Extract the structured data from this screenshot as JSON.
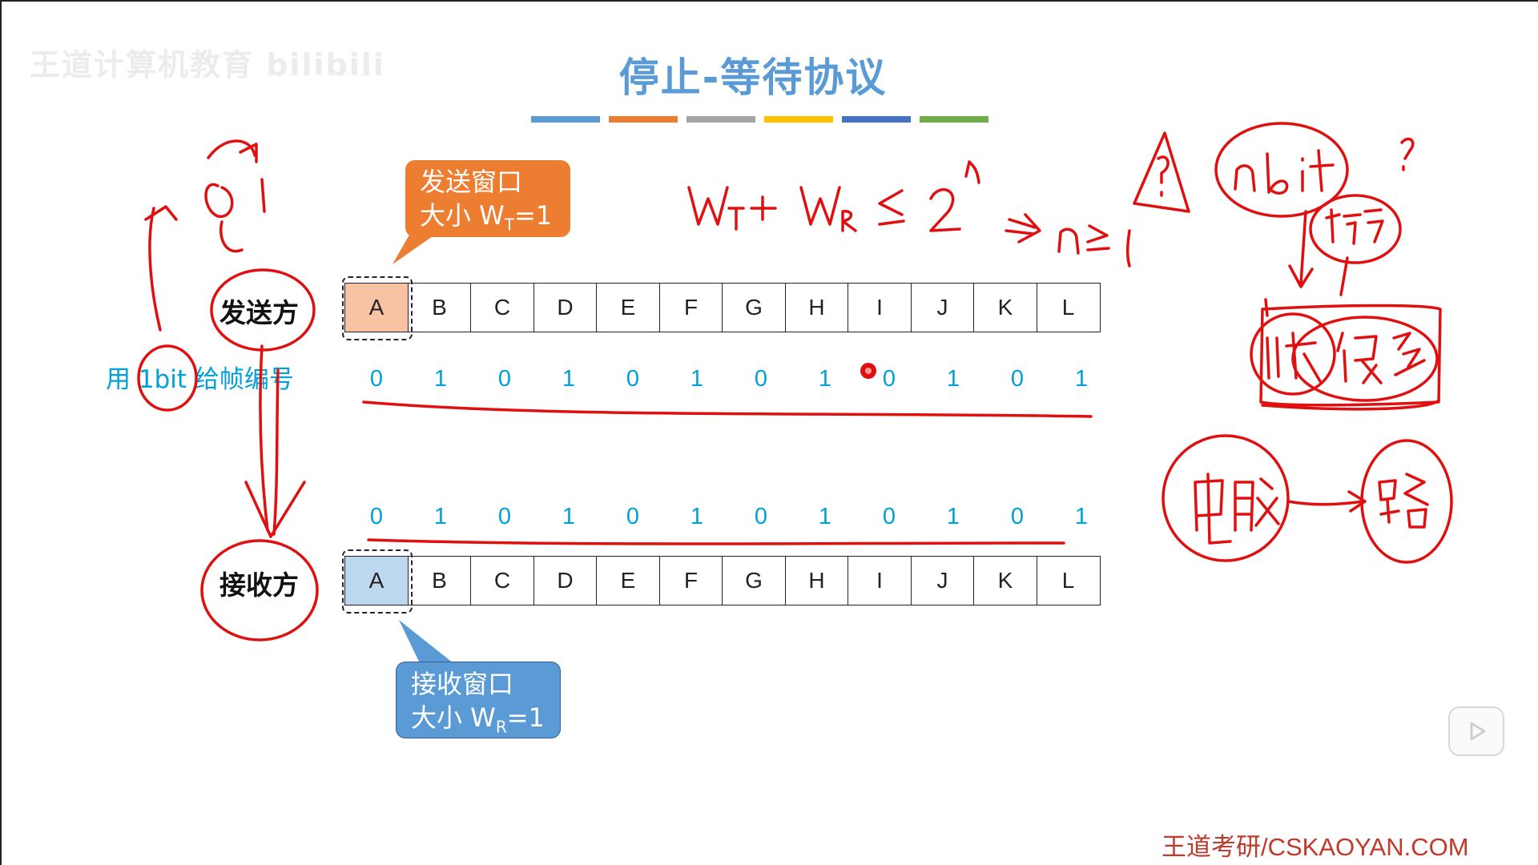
{
  "slide": {
    "title": "停止-等待协议",
    "watermark": "王道计算机教育 bilibili",
    "footer": "王道考研/CSKAOYAN.COM",
    "title_bar_colors": [
      "#5b9bd5",
      "#ed7d31",
      "#a5a5a5",
      "#ffc000",
      "#4472c4",
      "#70ad47"
    ]
  },
  "sender": {
    "label": "发送方",
    "frames": [
      "A",
      "B",
      "C",
      "D",
      "E",
      "F",
      "G",
      "H",
      "I",
      "J",
      "K",
      "L"
    ],
    "seq_numbers": [
      "0",
      "1",
      "0",
      "1",
      "0",
      "1",
      "0",
      "1",
      "0",
      "1",
      "0",
      "1"
    ],
    "window_callout": {
      "line1": "发送窗口",
      "line2_prefix": "大小 W",
      "line2_sub": "T",
      "line2_suffix": "=1",
      "color": "#ed7d31"
    }
  },
  "receiver": {
    "label": "接收方",
    "frames": [
      "A",
      "B",
      "C",
      "D",
      "E",
      "F",
      "G",
      "H",
      "I",
      "J",
      "K",
      "L"
    ],
    "seq_numbers": [
      "0",
      "1",
      "0",
      "1",
      "0",
      "1",
      "0",
      "1",
      "0",
      "1",
      "0",
      "1"
    ],
    "window_callout": {
      "line1": "接收窗口",
      "line2_prefix": "大小 W",
      "line2_sub": "R",
      "line2_suffix": "=1",
      "color": "#5b9bd5"
    }
  },
  "note": "用 1bit 给帧编号",
  "handwriting": {
    "ink_color": "#e01010",
    "formula_main": "W",
    "formula_sub_t": "T",
    "formula_plus": "+",
    "formula_sub_r": "R",
    "formula_le": "≤",
    "formula_base": "2",
    "formula_exp": "n",
    "implies": "⇒",
    "result": "n≥1",
    "nbit": "nbit",
    "question": "?",
    "numbering": "编号",
    "frames_many": "帧很多",
    "computer": "电脑",
    "router": "路",
    "warning": "!?"
  },
  "icons": {
    "play": "play-button-icon",
    "pointer": "laser-pointer-icon"
  }
}
